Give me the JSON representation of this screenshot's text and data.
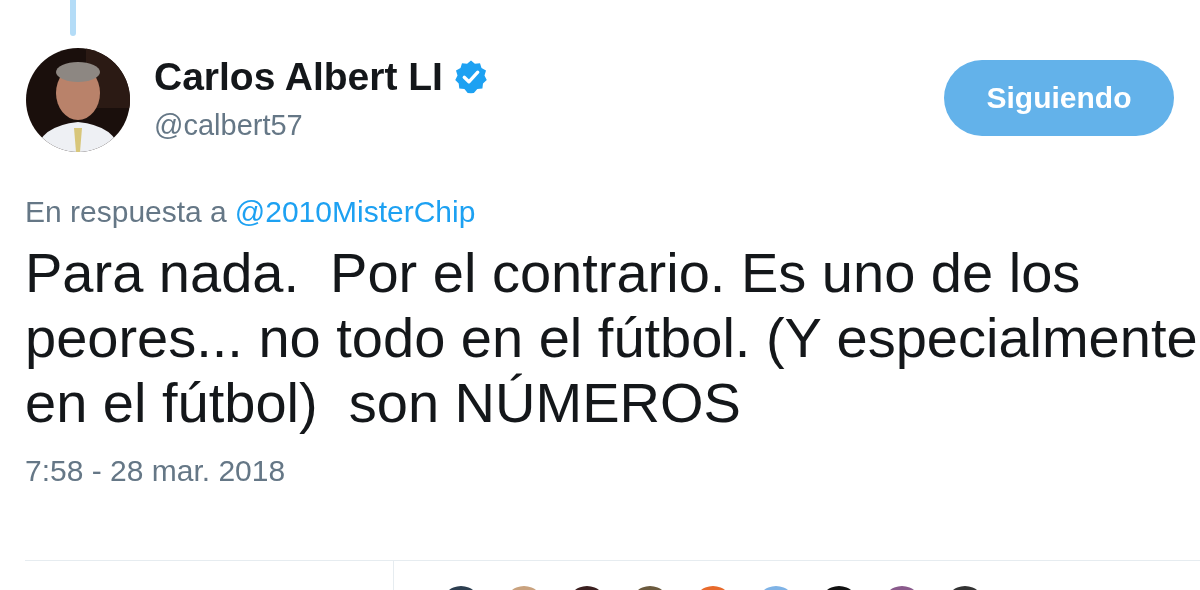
{
  "author": {
    "name": "Carlos Albert LI",
    "verified": true,
    "handle": "@calbert57"
  },
  "follow_button": {
    "label": "Siguiendo"
  },
  "reply_to": {
    "prefix": "En respuesta a",
    "mention": "@2010MisterChip"
  },
  "text": "Para nada.  Por el contrario. Es uno de los peores... no todo en el fútbol. (Y especialmente en el fútbol)  son NÚMEROS",
  "timestamp": "7:58 - 28 mar. 2018"
}
